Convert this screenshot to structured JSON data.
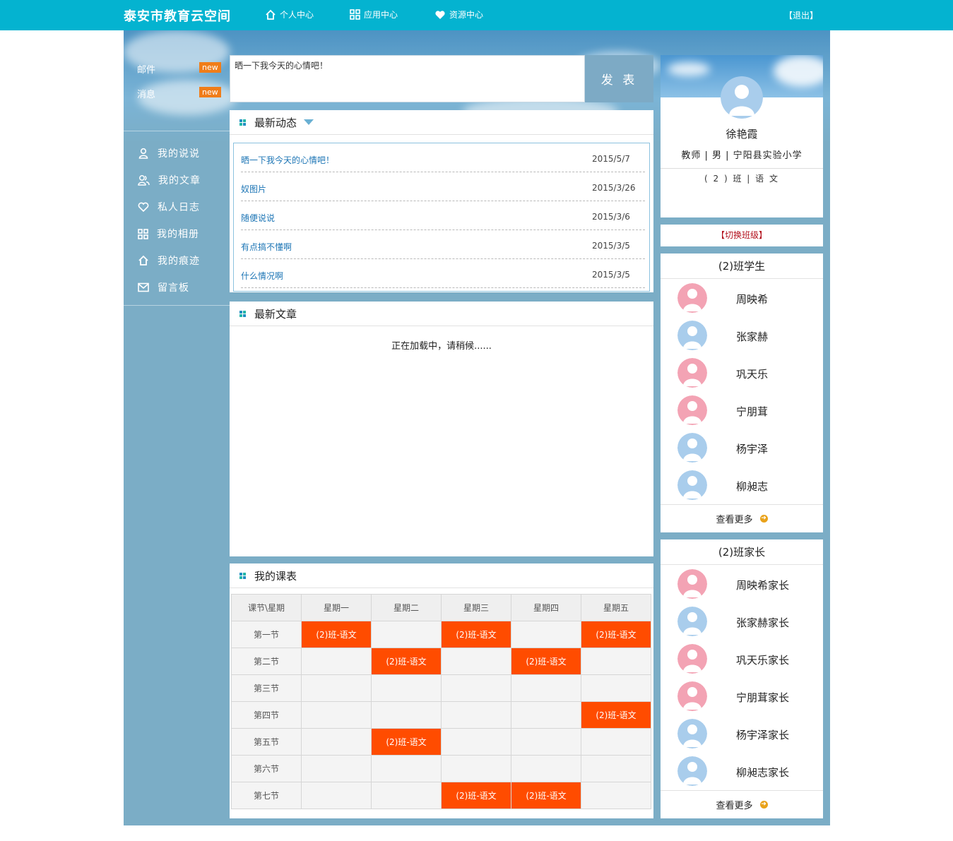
{
  "header": {
    "logo": "泰安市教育云空间",
    "nav": [
      {
        "label": "个人中心",
        "icon": "home-icon"
      },
      {
        "label": "应用中心",
        "icon": "grid-icon"
      },
      {
        "label": "资源中心",
        "icon": "heart-icon"
      }
    ],
    "logout": "【退出】"
  },
  "sidebar": {
    "notices": [
      {
        "label": "邮件",
        "badge": "new"
      },
      {
        "label": "消息",
        "badge": "new"
      }
    ],
    "menu": [
      {
        "label": "我的说说",
        "icon": "user-icon"
      },
      {
        "label": "我的文章",
        "icon": "users-icon"
      },
      {
        "label": "私人日志",
        "icon": "heart-icon"
      },
      {
        "label": "我的相册",
        "icon": "grid-icon"
      },
      {
        "label": "我的痕迹",
        "icon": "home-icon"
      },
      {
        "label": "留言板",
        "icon": "mail-icon"
      }
    ]
  },
  "post": {
    "placeholder": "晒一下我今天的心情吧！",
    "button": "发 表"
  },
  "news": {
    "title": "最新动态",
    "items": [
      {
        "title": "晒一下我今天的心情吧！",
        "date": "2015/5/7"
      },
      {
        "title": "奴图片",
        "date": "2015/3/26"
      },
      {
        "title": "随便说说",
        "date": "2015/3/6"
      },
      {
        "title": "有点搞不懂啊",
        "date": "2015/3/5"
      },
      {
        "title": "什么情况啊",
        "date": "2015/3/5"
      }
    ]
  },
  "articles": {
    "title": "最新文章",
    "loading": "正在加载中，请稍候......"
  },
  "timetable": {
    "title": "我的课表",
    "headers": [
      "课节\\星期",
      "星期一",
      "星期二",
      "星期三",
      "星期四",
      "星期五"
    ],
    "rows": [
      {
        "period": "第一节",
        "cells": [
          "(2)班-语文",
          "",
          "(2)班-语文",
          "",
          "(2)班-语文"
        ]
      },
      {
        "period": "第二节",
        "cells": [
          "",
          "(2)班-语文",
          "",
          "(2)班-语文",
          ""
        ]
      },
      {
        "period": "第三节",
        "cells": [
          "",
          "",
          "",
          "",
          ""
        ]
      },
      {
        "period": "第四节",
        "cells": [
          "",
          "",
          "",
          "",
          "(2)班-语文"
        ]
      },
      {
        "period": "第五节",
        "cells": [
          "",
          "(2)班-语文",
          "",
          "",
          ""
        ]
      },
      {
        "period": "第六节",
        "cells": [
          "",
          "",
          "",
          "",
          ""
        ]
      },
      {
        "period": "第七节",
        "cells": [
          "",
          "",
          "(2)班-语文",
          "(2)班-语文",
          ""
        ]
      }
    ]
  },
  "profile": {
    "name": "徐艳霞",
    "info": "教师 | 男 | 宁阳县实验小学",
    "class_subject": "( 2 ) 班 | 语 文",
    "switch_label": "【切换班级】"
  },
  "students": {
    "title": "(2)班学生",
    "items": [
      {
        "name": "周映希",
        "avatar": "female"
      },
      {
        "name": "张家赫",
        "avatar": "male"
      },
      {
        "name": "巩天乐",
        "avatar": "female"
      },
      {
        "name": "宁朋茸",
        "avatar": "female"
      },
      {
        "name": "杨宇泽",
        "avatar": "male"
      },
      {
        "name": "柳昶志",
        "avatar": "male"
      }
    ],
    "more": "查看更多"
  },
  "parents": {
    "title": "(2)班家长",
    "items": [
      {
        "name": "周映希家长",
        "avatar": "female"
      },
      {
        "name": "张家赫家长",
        "avatar": "male"
      },
      {
        "name": "巩天乐家长",
        "avatar": "female"
      },
      {
        "name": "宁朋茸家长",
        "avatar": "female"
      },
      {
        "name": "杨宇泽家长",
        "avatar": "male"
      },
      {
        "name": "柳昶志家长",
        "avatar": "male"
      }
    ],
    "more": "查看更多"
  },
  "colors": {
    "topbar": "#04b3d0",
    "frame": "#7badc6",
    "highlight": "#ff4c00",
    "link": "#1c75b5",
    "female_avatar": "#f3a3b4",
    "male_avatar": "#a9cdec"
  }
}
